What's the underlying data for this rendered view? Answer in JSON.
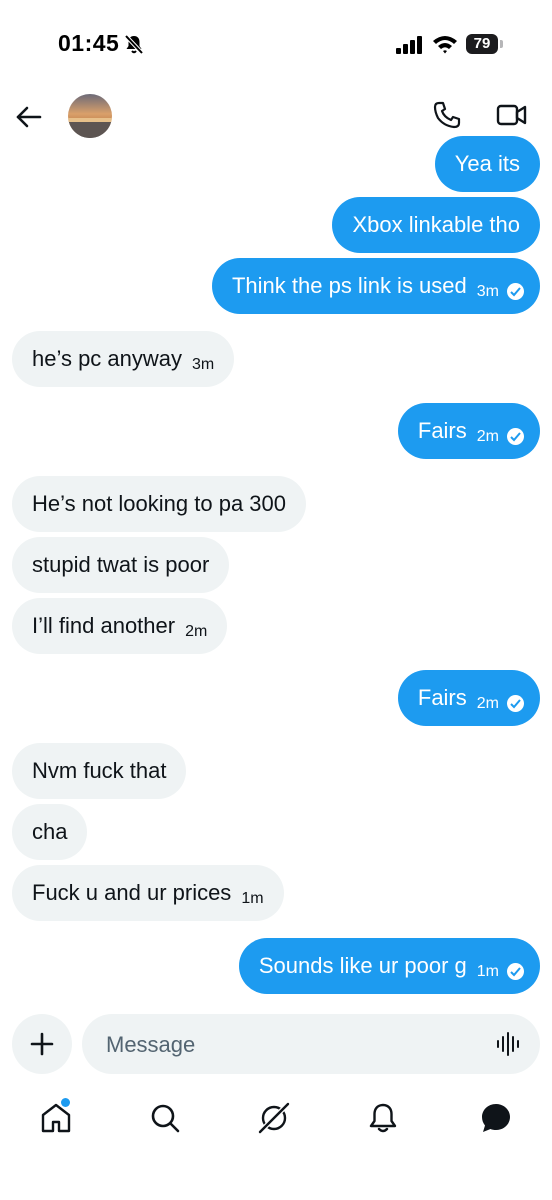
{
  "status_bar": {
    "time": "01:45",
    "battery": "79"
  },
  "header": {
    "avatar": "contact-avatar"
  },
  "messages": [
    {
      "side": "sent",
      "text": "Yea its",
      "time": ""
    },
    {
      "side": "sent",
      "text": "Xbox linkable tho",
      "time": ""
    },
    {
      "side": "sent",
      "text": "Think the ps link is used",
      "time": "3m"
    },
    {
      "side": "recv",
      "text": "he’s pc anyway",
      "time": "3m"
    },
    {
      "side": "sent",
      "text": "Fairs",
      "time": "2m"
    },
    {
      "side": "recv",
      "text": "He’s not looking to pa 300",
      "time": ""
    },
    {
      "side": "recv",
      "text": "stupid twat is poor",
      "time": ""
    },
    {
      "side": "recv",
      "text": "I’ll find another",
      "time": "2m"
    },
    {
      "side": "sent",
      "text": "Fairs",
      "time": "2m"
    },
    {
      "side": "recv",
      "text": "Nvm fuck that",
      "time": ""
    },
    {
      "side": "recv",
      "text": "cha",
      "time": ""
    },
    {
      "side": "recv",
      "text": "Fuck u and ur prices",
      "time": "1m"
    },
    {
      "side": "sent",
      "text": "Sounds like ur poor g",
      "time": "1m"
    }
  ],
  "composer": {
    "placeholder": "Message"
  },
  "nav": [
    "home-icon",
    "search-icon",
    "grok-icon",
    "notifications-icon",
    "messages-icon"
  ],
  "colors": {
    "accent": "#1d9bf0",
    "received_bubble": "#eff3f4",
    "text": "#0f1419"
  }
}
